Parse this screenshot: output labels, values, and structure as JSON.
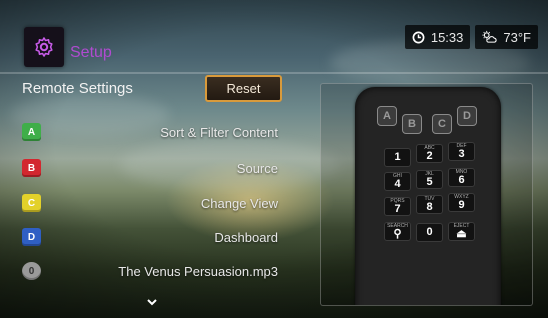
{
  "header": {
    "app_title": "Setup",
    "time": "15:33",
    "weather": "73°F",
    "icons": [
      "gear-icon",
      "clock-icon",
      "weather-icon"
    ]
  },
  "settings": {
    "section_title": "Remote Settings",
    "reset_label": "Reset",
    "items": [
      {
        "key": "A",
        "label": "Sort & Filter Content",
        "color": "#3fae49"
      },
      {
        "key": "B",
        "label": "Source",
        "color": "#d3272f"
      },
      {
        "key": "C",
        "label": "Change View",
        "color": "#e3d12a"
      },
      {
        "key": "D",
        "label": "Dashboard",
        "color": "#2f5fc4"
      },
      {
        "key": "0",
        "label": "The Venus Persuasion.mp3",
        "color": "#9a9a9a"
      }
    ]
  },
  "remote": {
    "color_keys": [
      "A",
      "B",
      "C",
      "D"
    ],
    "keys": [
      {
        "sub": "",
        "main": "1"
      },
      {
        "sub": "ABC",
        "main": "2"
      },
      {
        "sub": "DEF",
        "main": "3"
      },
      {
        "sub": "GHI",
        "main": "4"
      },
      {
        "sub": "JKL",
        "main": "5"
      },
      {
        "sub": "MNO",
        "main": "6"
      },
      {
        "sub": "PQRS",
        "main": "7"
      },
      {
        "sub": "TUV",
        "main": "8"
      },
      {
        "sub": "WXYZ",
        "main": "9"
      },
      {
        "sub": "SEARCH",
        "main": "⚲"
      },
      {
        "sub": "",
        "main": "0"
      },
      {
        "sub": "EJECT",
        "main": "⏏"
      }
    ]
  },
  "colors": {
    "accent": "#d99a3b",
    "title": "#b04bd0"
  }
}
